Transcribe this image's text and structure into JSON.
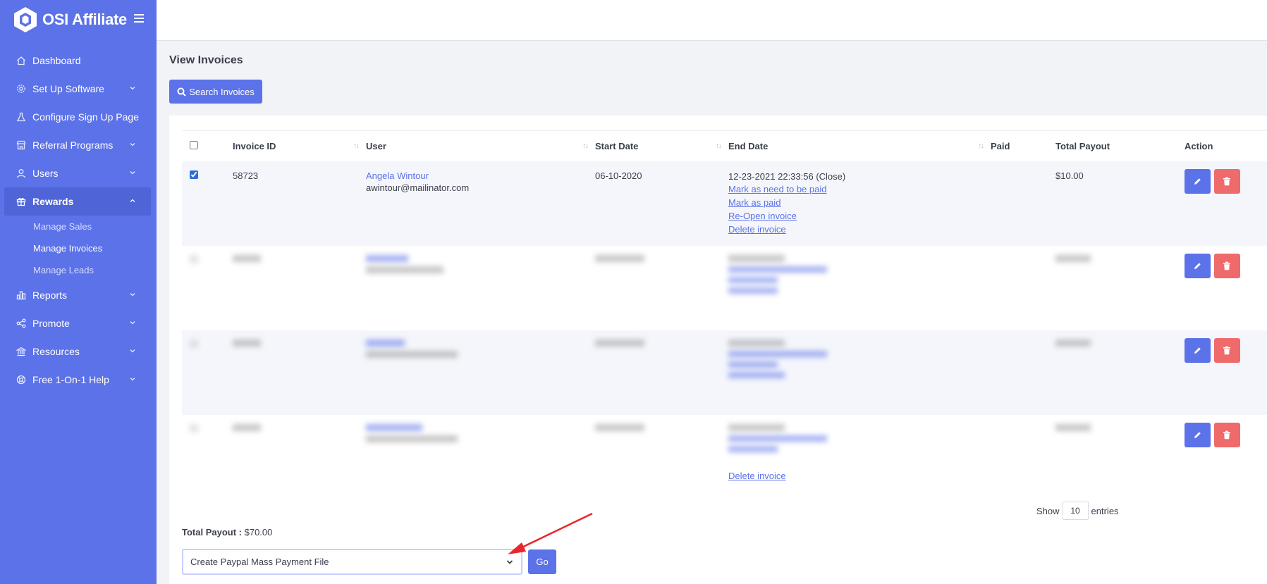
{
  "brand": {
    "name": "OSI Affiliate"
  },
  "sidebar": {
    "items": [
      {
        "label": "Dashboard",
        "icon": "home-icon",
        "has_chevron": false
      },
      {
        "label": "Set Up Software",
        "icon": "settings-icon",
        "has_chevron": true
      },
      {
        "label": "Configure Sign Up Page",
        "icon": "flask-icon",
        "has_chevron": false
      },
      {
        "label": "Referral Programs",
        "icon": "store-icon",
        "has_chevron": true
      },
      {
        "label": "Users",
        "icon": "user-icon",
        "has_chevron": true
      },
      {
        "label": "Rewards",
        "icon": "gift-icon",
        "has_chevron": true,
        "active": true
      },
      {
        "label": "Reports",
        "icon": "bar-chart-icon",
        "has_chevron": true
      },
      {
        "label": "Promote",
        "icon": "share-icon",
        "has_chevron": true
      },
      {
        "label": "Resources",
        "icon": "bank-icon",
        "has_chevron": true
      },
      {
        "label": "Free 1-On-1 Help",
        "icon": "lifebuoy-icon",
        "has_chevron": true
      }
    ],
    "rewards_sub": [
      "Manage Sales",
      "Manage Invoices",
      "Manage Leads"
    ]
  },
  "page": {
    "title": "View Invoices",
    "search_button": "Search Invoices"
  },
  "table": {
    "headers": [
      "Invoice ID",
      "User",
      "Start Date",
      "End Date",
      "Paid",
      "Total Payout",
      "Action"
    ],
    "rows": [
      {
        "invoice_id": "58723",
        "user_name": "Angela Wintour",
        "user_email": "awintour@mailinator.com",
        "start_date": "06-10-2020",
        "end_date": "12-23-2021 22:33:56 (Close)",
        "links": [
          "Mark as need to be paid",
          "Mark as paid",
          "Re-Open invoice",
          "Delete invoice"
        ],
        "paid": "",
        "total_payout": "$10.00",
        "checked": true
      }
    ],
    "last_row_link": "Delete invoice"
  },
  "footer": {
    "show_label": "Show",
    "entries_value": "10",
    "entries_label": "entries",
    "total_payout_label": "Total Payout :",
    "total_payout_value": "$70.00",
    "bulk_action": "Create Paypal Mass Payment File",
    "go_button": "Go"
  },
  "colors": {
    "sidebar": "#5c72e8",
    "accent": "#5c72e8",
    "danger": "#ef6a6a",
    "arrow": "#e8262b"
  }
}
